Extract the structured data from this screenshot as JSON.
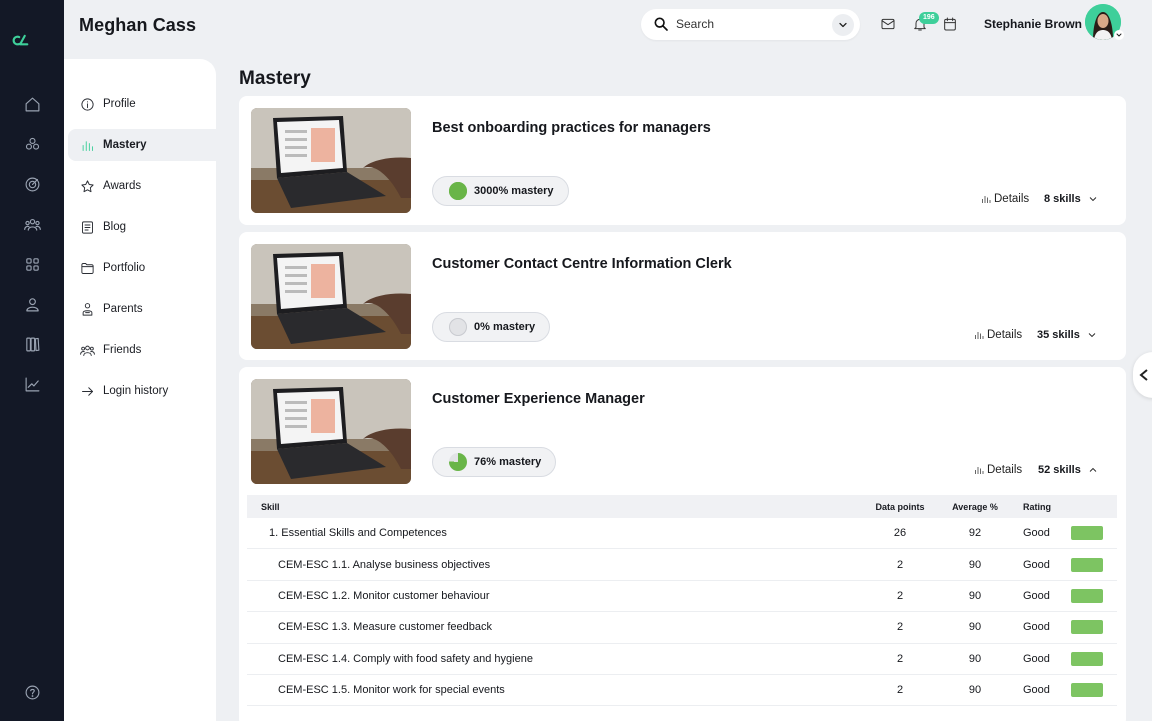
{
  "header": {
    "user_title": "Meghan Cass",
    "search_placeholder": "Search",
    "notification_count": "196",
    "account_name": "Stephanie Brown"
  },
  "rail_icons": [
    "home-icon",
    "modules-icon",
    "target-icon",
    "people-icon",
    "apps-icon",
    "user-icon",
    "library-icon",
    "chart-icon",
    "help-icon"
  ],
  "subnav": {
    "items": [
      {
        "label": "Profile",
        "icon": "info-icon"
      },
      {
        "label": "Mastery",
        "icon": "bar-chart-icon",
        "active": true
      },
      {
        "label": "Awards",
        "icon": "star-icon"
      },
      {
        "label": "Blog",
        "icon": "blog-icon"
      },
      {
        "label": "Portfolio",
        "icon": "folder-icon"
      },
      {
        "label": "Parents",
        "icon": "parent-icon"
      },
      {
        "label": "Friends",
        "icon": "friends-icon"
      },
      {
        "label": "Login history",
        "icon": "arrow-right-icon"
      }
    ]
  },
  "main": {
    "title": "Mastery",
    "courses": [
      {
        "title": "Best onboarding practices for managers",
        "mastery": "3000% mastery",
        "mastery_fraction": 1.0,
        "details": "Details",
        "skills": "8 skills"
      },
      {
        "title": "Customer Contact Centre Information Clerk",
        "mastery": "0% mastery",
        "mastery_fraction": 0.0,
        "details": "Details",
        "skills": "35 skills"
      },
      {
        "title": "Customer Experience Manager",
        "mastery": "76% mastery",
        "mastery_fraction": 0.76,
        "details": "Details",
        "skills": "52 skills"
      }
    ],
    "table": {
      "headers": {
        "skill": "Skill",
        "data_points": "Data points",
        "average": "Average %",
        "rating": "Rating"
      },
      "rows": [
        {
          "skill": "1. Essential Skills and Competences",
          "data_points": "26",
          "average": "92",
          "rating": "Good"
        },
        {
          "skill": "CEM-ESC 1.1. Analyse business objectives",
          "data_points": "2",
          "average": "90",
          "rating": "Good"
        },
        {
          "skill": "CEM-ESC 1.2. Monitor customer behaviour",
          "data_points": "2",
          "average": "90",
          "rating": "Good"
        },
        {
          "skill": "CEM-ESC 1.3. Measure customer feedback",
          "data_points": "2",
          "average": "90",
          "rating": "Good"
        },
        {
          "skill": "CEM-ESC 1.4. Comply with food safety and hygiene",
          "data_points": "2",
          "average": "90",
          "rating": "Good"
        },
        {
          "skill": "CEM-ESC 1.5. Monitor work for special events",
          "data_points": "2",
          "average": "90",
          "rating": "Good"
        }
      ]
    }
  },
  "colors": {
    "accent": "#3ecf9a",
    "rail": "#131826",
    "good": "#7dc462",
    "mastery_fill": "#69b548"
  }
}
